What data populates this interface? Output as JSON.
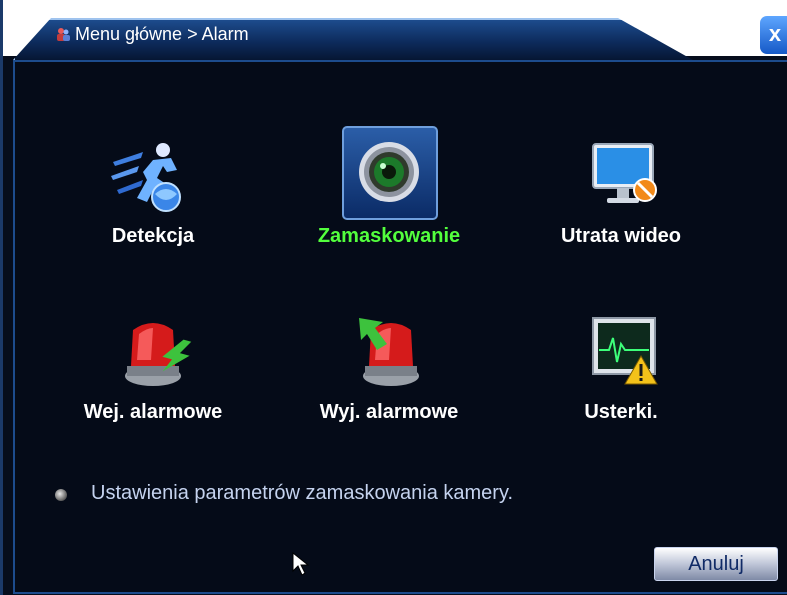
{
  "window": {
    "title": "Menu główne > Alarm",
    "close_glyph": "x"
  },
  "tiles": [
    {
      "label": "Detekcja",
      "icon": "motion-detection-icon",
      "selected": false
    },
    {
      "label": "Zamaskowanie",
      "icon": "camera-mask-eye-icon",
      "selected": true
    },
    {
      "label": "Utrata wideo",
      "icon": "video-loss-monitor-icon",
      "selected": false
    },
    {
      "label": "Wej. alarmowe",
      "icon": "alarm-input-siren-icon",
      "selected": false
    },
    {
      "label": "Wyj. alarmowe",
      "icon": "alarm-output-siren-icon",
      "selected": false
    },
    {
      "label": "Usterki.",
      "icon": "abnormality-warning-icon",
      "selected": false
    }
  ],
  "hint_text": "Ustawienia parametrów zamaskowania kamery.",
  "buttons": {
    "cancel_label": "Anuluj"
  },
  "colors": {
    "background": "#050b18",
    "title_bar": "#1d4c8d",
    "selected_label": "#53ff3d",
    "label": "#ffffff"
  }
}
